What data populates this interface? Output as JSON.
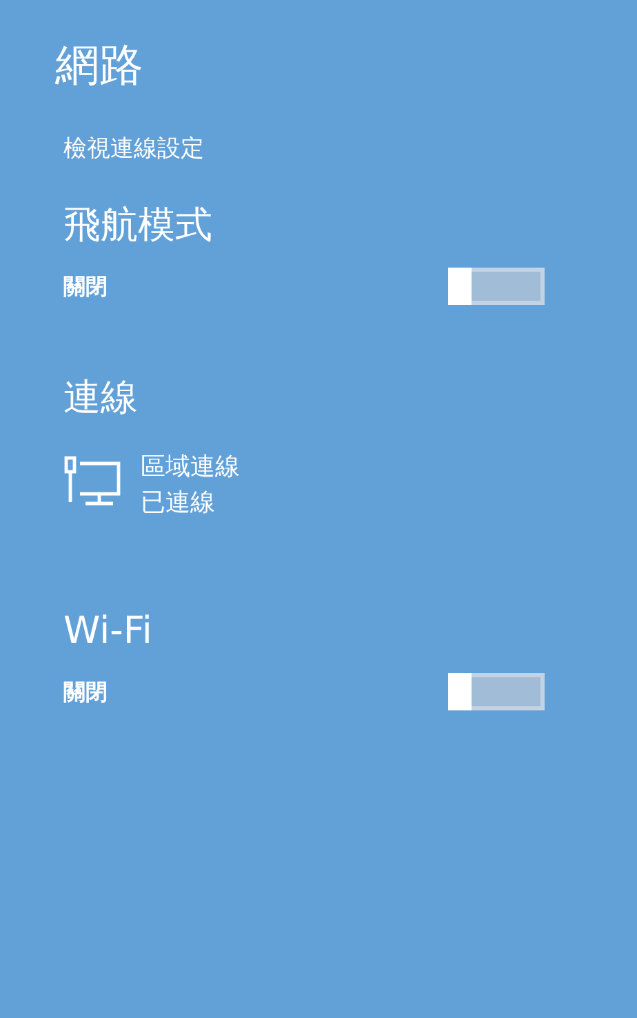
{
  "title": "網路",
  "link": "檢視連線設定",
  "sections": [
    {
      "kind": "toggle",
      "heading": "飛航模式",
      "state_label": "關閉",
      "on": false
    },
    {
      "kind": "connections",
      "heading": "連線",
      "items": [
        {
          "name": "區域連線",
          "status": "已連線"
        }
      ]
    },
    {
      "kind": "toggle",
      "heading": "Wi-Fi",
      "state_label": "關閉",
      "on": false
    }
  ]
}
